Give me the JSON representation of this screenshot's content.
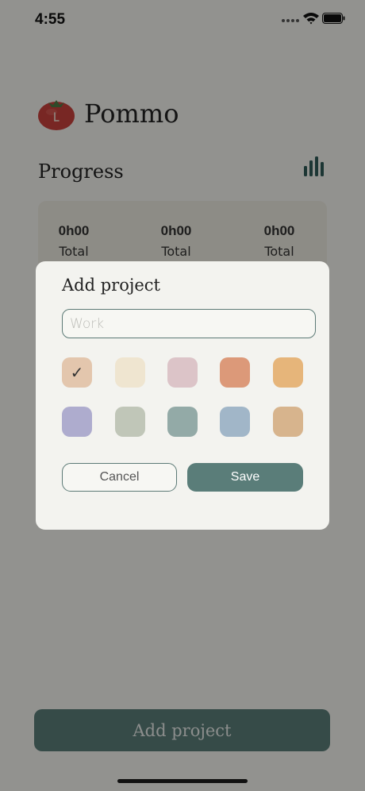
{
  "status_bar": {
    "time": "4:55"
  },
  "header": {
    "app_title": "Pommo",
    "logo_icon": "tomato-clock-icon"
  },
  "progress": {
    "title": "Progress",
    "stats_icon": "bar-chart-icon",
    "stats": [
      {
        "value": "0h00",
        "label": "Total"
      },
      {
        "value": "0h00",
        "label": "Total"
      },
      {
        "value": "0h00",
        "label": "Total"
      }
    ]
  },
  "modal": {
    "title": "Add project",
    "name_input": {
      "value": "",
      "placeholder": "Work"
    },
    "colors": [
      {
        "hex": "#e3c6ad",
        "selected": true
      },
      {
        "hex": "#efe5d0",
        "selected": false
      },
      {
        "hex": "#dcc4c8",
        "selected": false
      },
      {
        "hex": "#dc9979",
        "selected": false
      },
      {
        "hex": "#e6b57a",
        "selected": false
      },
      {
        "hex": "#aeacce",
        "selected": false
      },
      {
        "hex": "#c0c6b8",
        "selected": false
      },
      {
        "hex": "#93aaa7",
        "selected": false
      },
      {
        "hex": "#a1b6c8",
        "selected": false
      },
      {
        "hex": "#d7b48d",
        "selected": false
      }
    ],
    "check_glyph": "✓",
    "cancel_label": "Cancel",
    "save_label": "Save"
  },
  "bottom": {
    "add_project_label": "Add project"
  },
  "theme": {
    "accent": "#5a7d79",
    "overlay": "rgba(0,0,0,0.4)"
  }
}
